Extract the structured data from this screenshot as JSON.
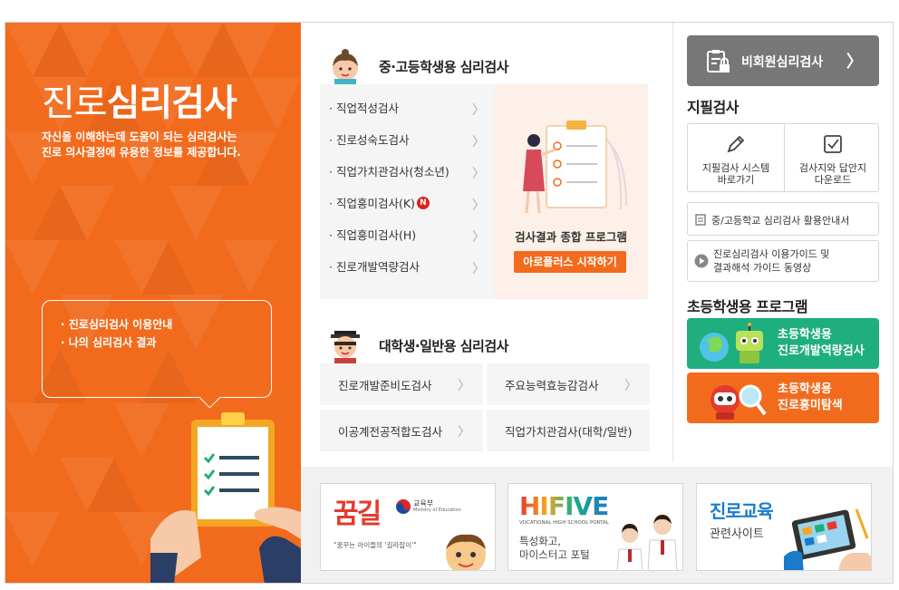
{
  "hero": {
    "title_light": "진로",
    "title_bold": "심리검사",
    "desc": [
      "자신을 이해하는데 도움이 되는 심리검사는",
      "진로 의사결정에 유용한 정보를 제공합니다."
    ],
    "links": [
      "· 진로심리검사 이용안내",
      "· 나의 심리검사 결과"
    ]
  },
  "middle_school": {
    "title": "중·고등학생용 심리검사",
    "items": [
      {
        "label": "· 직업적성검사",
        "new": false
      },
      {
        "label": "· 진로성숙도검사",
        "new": false
      },
      {
        "label": "· 직업가치관검사(청소년)",
        "new": false
      },
      {
        "label": "· 직업흥미검사(K)",
        "new": true
      },
      {
        "label": "· 직업흥미검사(H)",
        "new": false
      },
      {
        "label": "· 진로개발역량검사",
        "new": false
      }
    ],
    "new_badge": "N",
    "chevron": "〉",
    "result_label": "검사결과 종합 프로그램",
    "result_button": "아로플러스 시작하기"
  },
  "adult": {
    "title": "대학생·일반용 심리검사",
    "items": [
      "진로개발준비도검사",
      "주요능력효능감검사",
      "이공계전공적합도검사",
      "직업가치관검사(대학/일반)"
    ]
  },
  "right": {
    "nonmember_button": "비회원심리검사",
    "arrow": "〉",
    "paper_title": "지필검사",
    "paper_items": [
      [
        "지필검사 시스템",
        "바로가기"
      ],
      [
        "검사지와 답안지",
        "다운로드"
      ]
    ],
    "guide_doc": "중/고등학교 심리검사 활용안내서",
    "guide_video": [
      "진로심리검사 이용가이드 및",
      "결과해석 가이드 동영상"
    ],
    "elem_title": "초등학생용 프로그램",
    "elem_buttons": [
      {
        "lines": [
          "초등학생용",
          "진로개발역량검사"
        ],
        "color": "#1fae7d"
      },
      {
        "lines": [
          "초등학생용",
          "진로흥미탐색"
        ],
        "color": "#f26b1d"
      }
    ]
  },
  "banners": {
    "kkumgil": {
      "logo": "꿈길",
      "ministry": "교육부",
      "ministry_en": "Ministry of Education",
      "slogan": "\"꿈꾸는 아이들의 '길라잡이'\""
    },
    "hifive": {
      "logo": "HIFIVE",
      "subtitle": "VOCATIONAL HIGH SCHOOL PORTAL",
      "lines": [
        "특성화고,",
        "마이스터고 포털"
      ]
    },
    "career": {
      "title": "진로교육",
      "subtitle": "관련사이트"
    }
  },
  "colors": {
    "orange": "#f26b1d",
    "green": "#1fae7d",
    "gray_button": "#777777"
  }
}
